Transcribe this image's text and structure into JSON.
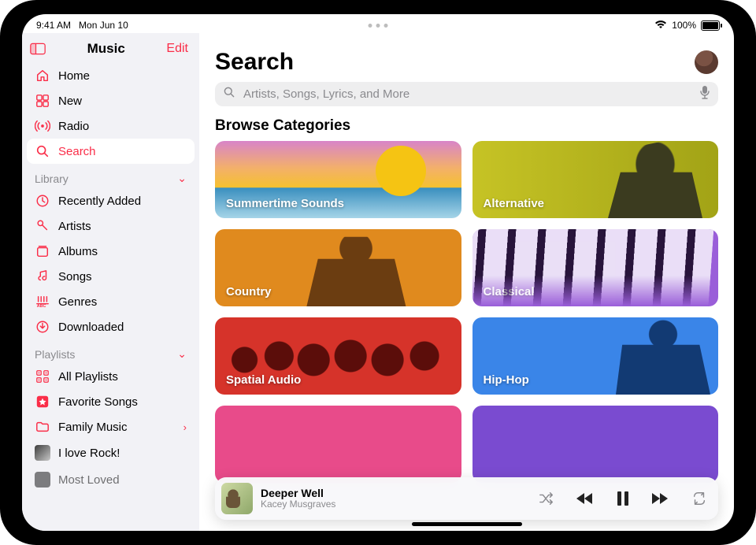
{
  "status": {
    "time": "9:41 AM",
    "date": "Mon Jun 10",
    "battery_pct": "100%"
  },
  "sidebar": {
    "app_title": "Music",
    "edit_label": "Edit",
    "nav": [
      {
        "id": "home",
        "label": "Home",
        "icon": "home-icon"
      },
      {
        "id": "new",
        "label": "New",
        "icon": "grid-icon"
      },
      {
        "id": "radio",
        "label": "Radio",
        "icon": "radio-icon"
      },
      {
        "id": "search",
        "label": "Search",
        "icon": "search-icon",
        "selected": true
      }
    ],
    "library": {
      "label": "Library",
      "items": [
        {
          "id": "recently-added",
          "label": "Recently Added",
          "icon": "clock-icon"
        },
        {
          "id": "artists",
          "label": "Artists",
          "icon": "mic-icon"
        },
        {
          "id": "albums",
          "label": "Albums",
          "icon": "album-icon"
        },
        {
          "id": "songs",
          "label": "Songs",
          "icon": "note-icon"
        },
        {
          "id": "genres",
          "label": "Genres",
          "icon": "guitar-icon"
        },
        {
          "id": "downloaded",
          "label": "Downloaded",
          "icon": "download-icon"
        }
      ]
    },
    "playlists": {
      "label": "Playlists",
      "items": [
        {
          "id": "all-playlists",
          "label": "All Playlists",
          "icon": "playlist-grid-icon"
        },
        {
          "id": "favorite-songs",
          "label": "Favorite Songs",
          "icon": "star-icon"
        },
        {
          "id": "family-music",
          "label": "Family Music",
          "icon": "folder-icon",
          "has_chevron": true
        },
        {
          "id": "i-love-rock",
          "label": "I love Rock!",
          "art_color": "linear-gradient(135deg,#4a4a4a,#bcbcbc)"
        },
        {
          "id": "most-loved",
          "label": "Most Loved",
          "art_color": "#1c1c1e"
        }
      ]
    }
  },
  "main": {
    "title": "Search",
    "search_placeholder": "Artists, Songs, Lyrics, and More",
    "browse_title": "Browse Categories",
    "categories": [
      {
        "id": "summertime",
        "label": "Summertime Sounds",
        "bg": "bg-summertime"
      },
      {
        "id": "alternative",
        "label": "Alternative",
        "bg": "bg-alternative"
      },
      {
        "id": "country",
        "label": "Country",
        "bg": "bg-country"
      },
      {
        "id": "classical",
        "label": "Classical",
        "bg": "bg-classical"
      },
      {
        "id": "spatial",
        "label": "Spatial Audio",
        "bg": "bg-spatial"
      },
      {
        "id": "hiphop",
        "label": "Hip-Hop",
        "bg": "bg-hiphop"
      },
      {
        "id": "pink",
        "label": "",
        "bg": "bg-pink"
      },
      {
        "id": "purple",
        "label": "",
        "bg": "bg-purple"
      }
    ]
  },
  "now_playing": {
    "title": "Deeper Well",
    "artist": "Kacey Musgraves"
  }
}
